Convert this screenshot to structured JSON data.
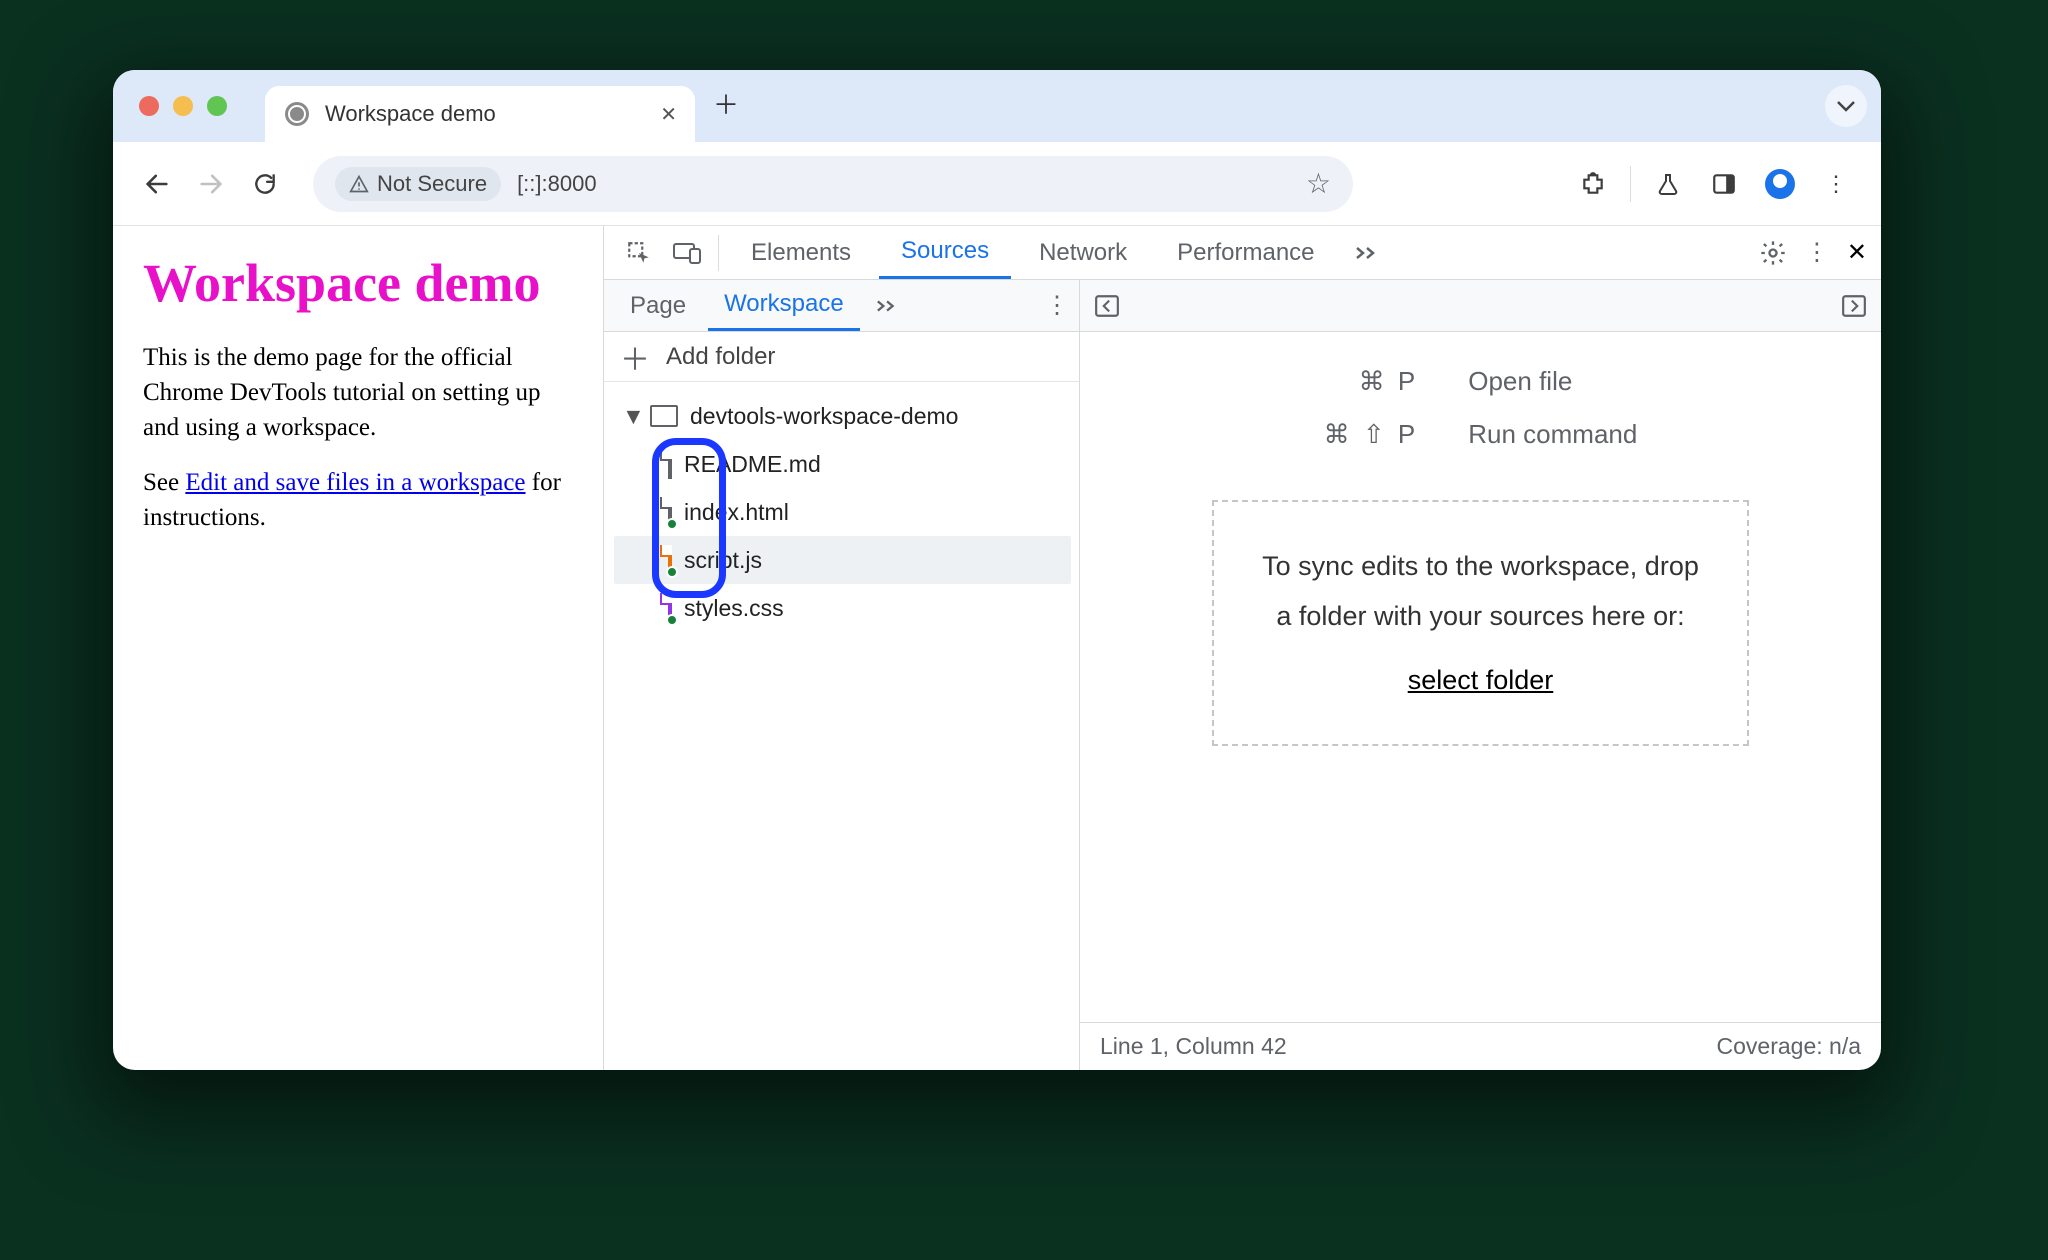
{
  "browser": {
    "tab_title": "Workspace demo",
    "security_label": "Not Secure",
    "url": "[::]:8000"
  },
  "page": {
    "heading": "Workspace demo",
    "p1": "This is the demo page for the official Chrome DevTools tutorial on setting up and using a workspace.",
    "p2_prefix": "See ",
    "p2_link": "Edit and save files in a workspace",
    "p2_suffix": " for instructions."
  },
  "devtools": {
    "main_tabs": {
      "elements": "Elements",
      "sources": "Sources",
      "network": "Network",
      "performance": "Performance"
    },
    "sources_tabs": {
      "page": "Page",
      "workspace": "Workspace"
    },
    "add_folder": "Add folder",
    "tree": {
      "root": "devtools-workspace-demo",
      "files": [
        "README.md",
        "index.html",
        "script.js",
        "styles.css"
      ]
    },
    "shortcuts": {
      "openfile_key": "⌘  P",
      "openfile_label": "Open file",
      "runcmd_key": "⌘  ⇧  P",
      "runcmd_label": "Run command"
    },
    "dropzone": {
      "line1": "To sync edits to the workspace, drop",
      "line2": "a folder with your sources here or:",
      "link": "select folder"
    },
    "status": {
      "pos": "Line 1, Column 42",
      "coverage": "Coverage: n/a"
    }
  }
}
